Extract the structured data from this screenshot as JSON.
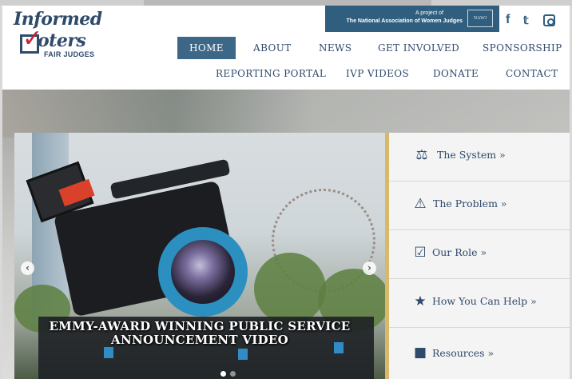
{
  "logo": {
    "line1": "Informed",
    "line2": "oters",
    "line3": "FAIR JUDGES",
    "check_icon": "check-icon"
  },
  "project_banner": {
    "line1": "A project of",
    "line2": "The National Association of Women Judges",
    "seal_text": "NAWJ"
  },
  "social": {
    "facebook": "f",
    "twitter": "🐦",
    "instagram_icon": "instagram-icon"
  },
  "nav": {
    "row1": [
      "HOME",
      "ABOUT",
      "NEWS",
      "GET INVOLVED",
      "SPONSORSHIP"
    ],
    "row2": [
      "REPORTING PORTAL",
      "IVP VIDEOS",
      "DONATE",
      "CONTACT"
    ],
    "active": "HOME"
  },
  "slider": {
    "caption_line1": "EMMY-AWARD WINNING PUBLIC SERVICE",
    "caption_line2": "ANNOUNCEMENT VIDEO",
    "prev": "‹",
    "next": "›",
    "slide_count": 2,
    "active_slide": 1
  },
  "side_menu": [
    {
      "label": "The System »",
      "icon": "scales-icon"
    },
    {
      "label": "The Problem »",
      "icon": "warning-icon"
    },
    {
      "label": "Our Role »",
      "icon": "checkbox-icon"
    },
    {
      "label": "How You Can Help »",
      "icon": "star-icon"
    },
    {
      "label": "Resources »",
      "icon": "video-camera-icon"
    }
  ],
  "colors": {
    "brand_navy": "#2f4a6b",
    "nav_active": "#3d6787",
    "banner": "#2f5e7e",
    "accent_red": "#c8202f",
    "gold": "#d9b86a"
  }
}
